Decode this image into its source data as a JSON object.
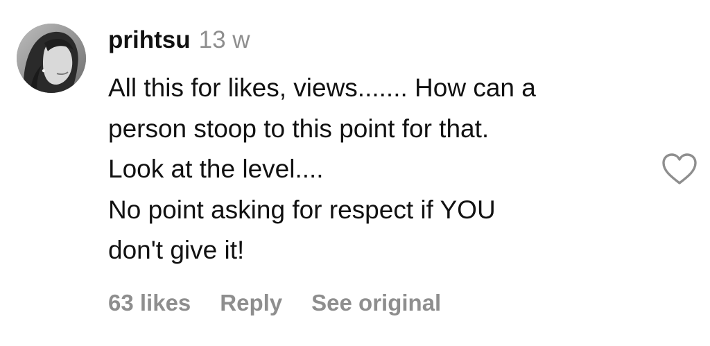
{
  "comment": {
    "username": "prihtsu",
    "time_ago": "13 w",
    "text_lines": [
      "All this for likes, views....... How can a",
      "person stoop to this point for that.",
      "Look at the level....",
      "No point asking for respect if YOU",
      "don't give it!"
    ],
    "likes_label": "63 likes",
    "reply_label": "Reply",
    "see_original_label": "See original",
    "like_icon": "heart-outline-icon",
    "avatar_icon": "profile-photo",
    "colors": {
      "text": "#111111",
      "muted": "#8e8e8e",
      "background": "#ffffff"
    }
  }
}
